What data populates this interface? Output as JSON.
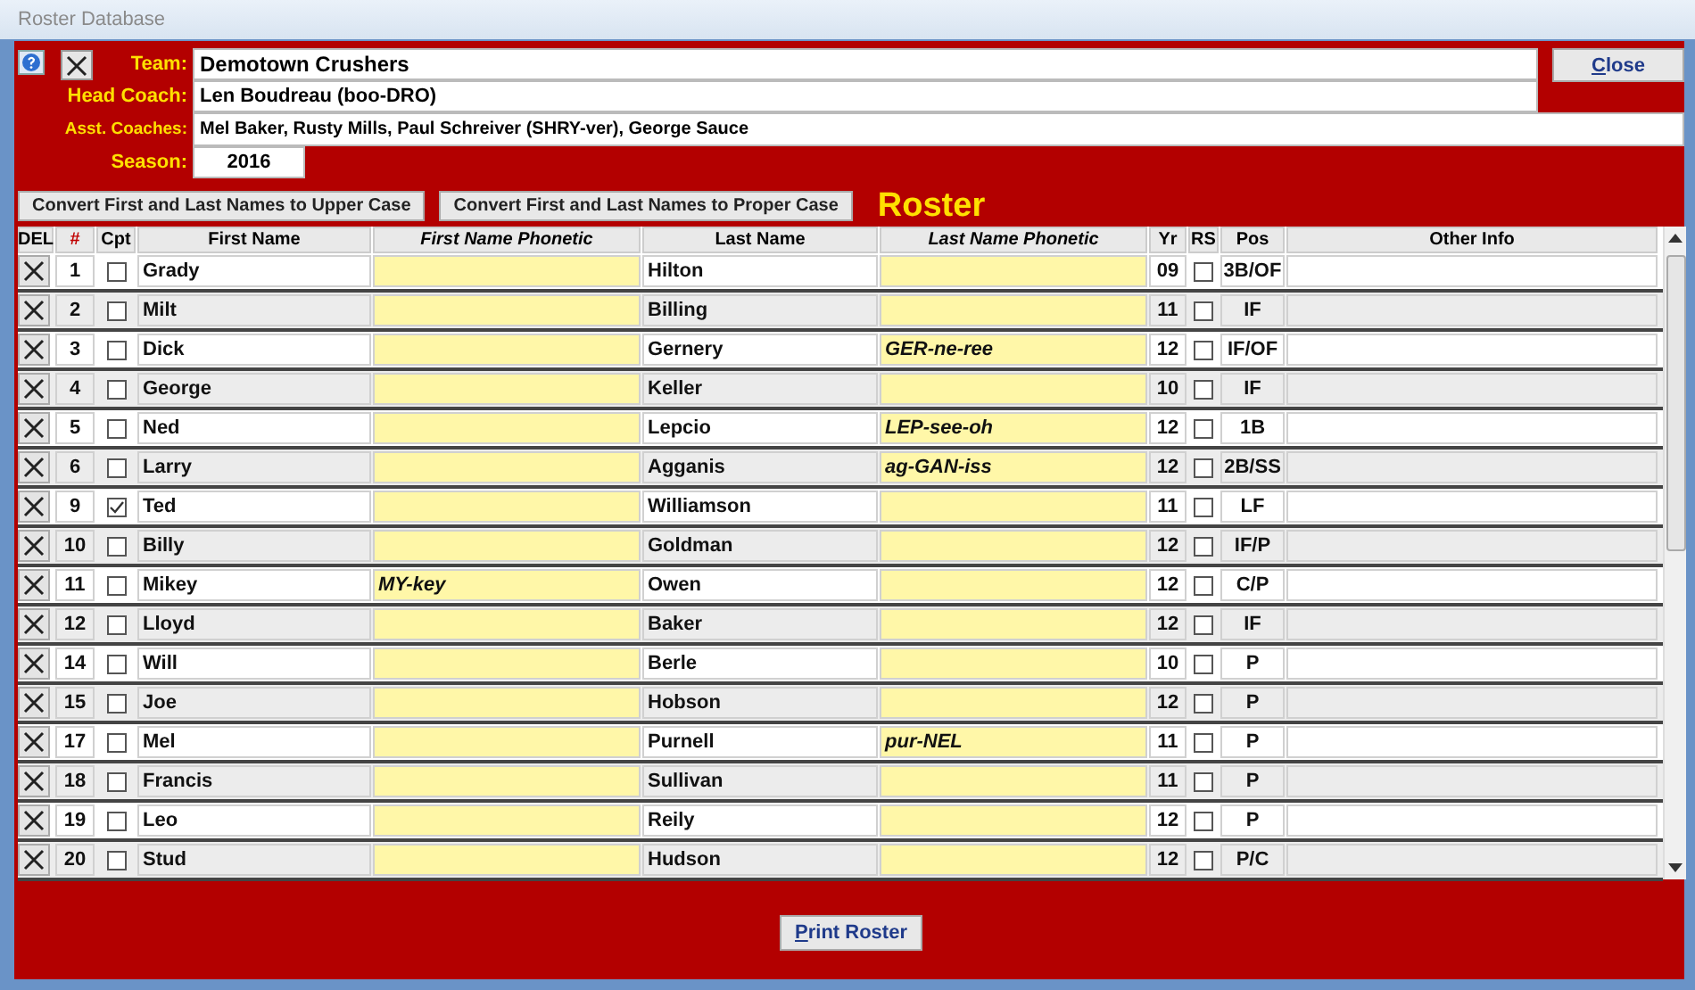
{
  "window": {
    "title": "Roster Database"
  },
  "header": {
    "team_label": "Team:",
    "team": "Demotown Crushers",
    "head_coach_label": "Head Coach:",
    "head_coach": "Len Boudreau (boo-DRO)",
    "asst_label": "Asst. Coaches:",
    "asst_coaches": "Mel Baker, Rusty Mills, Paul Schreiver (SHRY-ver), George Sauce",
    "season_label": "Season:",
    "season": "2016"
  },
  "close_button": "Close",
  "buttons": [
    "Convert First and Last Names to Upper Case",
    "Convert First and Last Names to Proper Case"
  ],
  "roster_title": "Roster",
  "table": {
    "columns": [
      "DEL",
      "#",
      "Cpt",
      "First Name",
      "First Name Phonetic",
      "Last Name",
      "Last Name Phonetic",
      "Yr",
      "RS",
      "Pos",
      "Other Info"
    ],
    "rows": [
      {
        "number": "1",
        "captain": false,
        "first": "Grady",
        "last": "Hilton",
        "yr": "09",
        "rs": false,
        "pos": "3B/OF"
      },
      {
        "number": "2",
        "captain": false,
        "first": "Milt",
        "last": "Billing",
        "yr": "11",
        "rs": false,
        "pos": "IF"
      },
      {
        "number": "3",
        "captain": false,
        "first": "Dick",
        "last": "Gernery",
        "last_phonetic": "GER-ne-ree",
        "yr": "12",
        "rs": false,
        "pos": "IF/OF"
      },
      {
        "number": "4",
        "captain": false,
        "first": "George",
        "last": "Keller",
        "yr": "10",
        "rs": false,
        "pos": "IF"
      },
      {
        "number": "5",
        "captain": false,
        "first": "Ned",
        "last": "Lepcio",
        "last_phonetic": "LEP-see-oh",
        "yr": "12",
        "rs": false,
        "pos": "1B"
      },
      {
        "number": "6",
        "captain": false,
        "first": "Larry",
        "last": "Agganis",
        "last_phonetic": "ag-GAN-iss",
        "yr": "12",
        "rs": false,
        "pos": "2B/SS"
      },
      {
        "number": "9",
        "captain": true,
        "first": "Ted",
        "last": "Williamson",
        "yr": "11",
        "rs": false,
        "pos": "LF"
      },
      {
        "number": "10",
        "captain": false,
        "first": "Billy",
        "last": "Goldman",
        "yr": "12",
        "rs": false,
        "pos": "IF/P"
      },
      {
        "number": "11",
        "captain": false,
        "first": "Mikey",
        "first_phonetic": "MY-key",
        "last": "Owen",
        "yr": "12",
        "rs": false,
        "pos": "C/P"
      },
      {
        "number": "12",
        "captain": false,
        "first": "Lloyd",
        "last": "Baker",
        "yr": "12",
        "rs": false,
        "pos": "IF"
      },
      {
        "number": "14",
        "captain": false,
        "first": "Will",
        "last": "Berle",
        "yr": "10",
        "rs": false,
        "pos": "P"
      },
      {
        "number": "15",
        "captain": false,
        "first": "Joe",
        "last": "Hobson",
        "yr": "12",
        "rs": false,
        "pos": "P"
      },
      {
        "number": "17",
        "captain": false,
        "first": "Mel",
        "last": "Purnell",
        "last_phonetic": "pur-NEL",
        "yr": "11",
        "rs": false,
        "pos": "P"
      },
      {
        "number": "18",
        "captain": false,
        "first": "Francis",
        "last": "Sullivan",
        "yr": "11",
        "rs": false,
        "pos": "P"
      },
      {
        "number": "19",
        "captain": false,
        "first": "Leo",
        "last": "Reily",
        "yr": "12",
        "rs": false,
        "pos": "P"
      },
      {
        "number": "20",
        "captain": false,
        "first": "Stud",
        "last": "Hudson",
        "yr": "12",
        "rs": false,
        "pos": "P/C"
      }
    ]
  },
  "print_button": "Print Roster"
}
